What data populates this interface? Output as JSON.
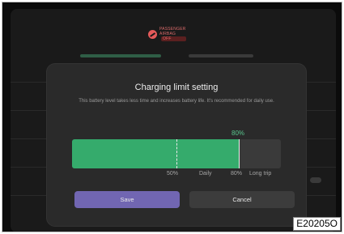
{
  "status_bar": {
    "airbag_line1": "PASSENGER",
    "airbag_line2": "AIRBAG",
    "airbag_state": "OFF"
  },
  "dialog": {
    "title": "Charging limit setting",
    "description": "This battery level takes less time and increases battery life. It's recommended for daily use.",
    "current_value_label": "80%",
    "current_value_percent": 80,
    "markers": [
      {
        "label": "50%"
      },
      {
        "label": "Daily"
      },
      {
        "label": "80%"
      },
      {
        "label": "Long trip"
      }
    ],
    "save_label": "Save",
    "cancel_label": "Cancel"
  },
  "colors": {
    "fill": "#35ab6c",
    "accent_text": "#58c58d",
    "save_button": "#7166b2",
    "cancel_button": "#3c3c3c"
  },
  "reference_code": "E20205O"
}
